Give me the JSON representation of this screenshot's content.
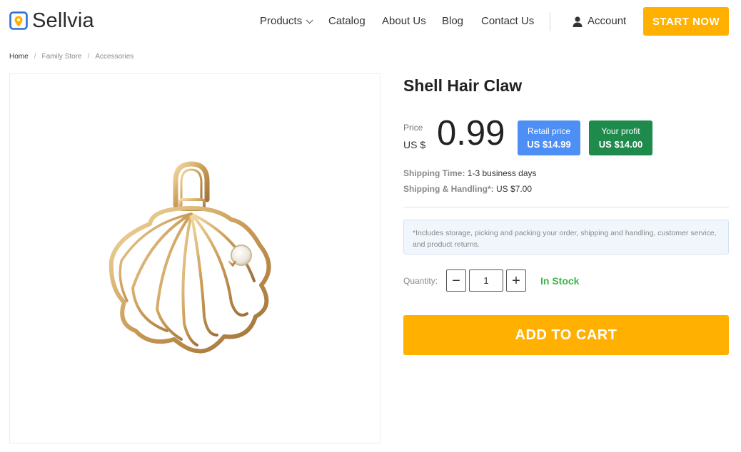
{
  "header": {
    "logo_text": "Sellvia",
    "logo_icon": "location-pin-icon",
    "nav": {
      "products": "Products",
      "catalog": "Catalog",
      "about": "About Us",
      "blog": "Blog",
      "contact": "Contact Us"
    },
    "account_label": "Account",
    "account_icon": "user-icon",
    "start_label": "START NOW"
  },
  "breadcrumb": [
    "Home",
    "Family Store",
    "Accessories"
  ],
  "product": {
    "title": "Shell Hair Claw",
    "price_label": "Price",
    "currency": "US $",
    "price": "0.99",
    "retail": {
      "label": "Retail price",
      "value": "US $14.99"
    },
    "profit": {
      "label": "Your profit",
      "value": "US $14.00"
    },
    "shipping_time_label": "Shipping Time:",
    "shipping_time_value": "1-3 business days",
    "shipping_handling_label": "Shipping & Handling*:",
    "shipping_handling_value": "US $7.00",
    "note": "*Includes storage, picking and packing your order, shipping and handling, customer service, and product returns.",
    "quantity_label": "Quantity:",
    "quantity_value": "1",
    "stock_status": "In Stock",
    "add_to_cart": "ADD TO CART"
  },
  "colors": {
    "accent": "#ffb000",
    "retail_badge": "#4d8ff4",
    "profit_badge": "#1e8a4c",
    "in_stock": "#3bb54a"
  }
}
